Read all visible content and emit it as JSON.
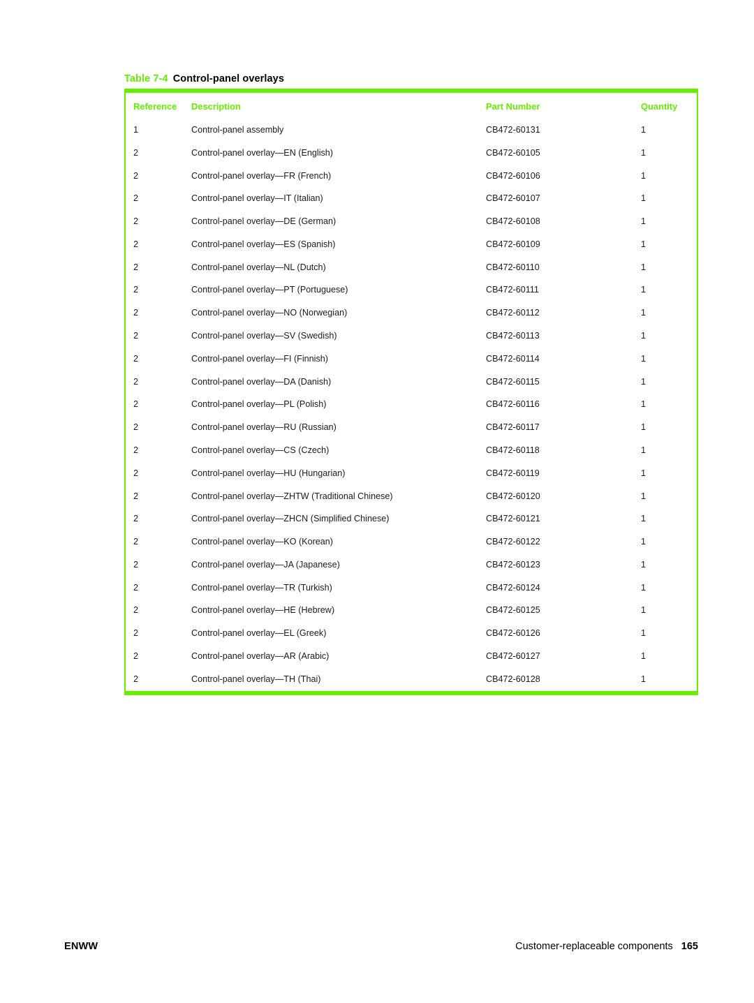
{
  "caption": {
    "label": "Table 7-4",
    "title": "Control-panel overlays"
  },
  "colors": {
    "accent_green": "#66ee00",
    "body_text": "#1a1a1a"
  },
  "table": {
    "headers": {
      "reference": "Reference",
      "description": "Description",
      "part_number": "Part Number",
      "quantity": "Quantity"
    },
    "rows": [
      {
        "reference": "1",
        "description": "Control-panel assembly",
        "part_number": "CB472-60131",
        "quantity": "1"
      },
      {
        "reference": "2",
        "description": "Control-panel overlay—EN (English)",
        "part_number": "CB472-60105",
        "quantity": "1"
      },
      {
        "reference": "2",
        "description": "Control-panel overlay—FR (French)",
        "part_number": "CB472-60106",
        "quantity": "1"
      },
      {
        "reference": "2",
        "description": "Control-panel overlay—IT (Italian)",
        "part_number": "CB472-60107",
        "quantity": "1"
      },
      {
        "reference": "2",
        "description": "Control-panel overlay—DE (German)",
        "part_number": "CB472-60108",
        "quantity": "1"
      },
      {
        "reference": "2",
        "description": "Control-panel overlay—ES (Spanish)",
        "part_number": "CB472-60109",
        "quantity": "1"
      },
      {
        "reference": "2",
        "description": "Control-panel overlay—NL (Dutch)",
        "part_number": "CB472-60110",
        "quantity": "1"
      },
      {
        "reference": "2",
        "description": "Control-panel overlay—PT (Portuguese)",
        "part_number": "CB472-60111",
        "quantity": "1"
      },
      {
        "reference": "2",
        "description": "Control-panel overlay—NO (Norwegian)",
        "part_number": "CB472-60112",
        "quantity": "1"
      },
      {
        "reference": "2",
        "description": "Control-panel overlay—SV (Swedish)",
        "part_number": "CB472-60113",
        "quantity": "1"
      },
      {
        "reference": "2",
        "description": "Control-panel overlay—FI (Finnish)",
        "part_number": "CB472-60114",
        "quantity": "1"
      },
      {
        "reference": "2",
        "description": "Control-panel overlay—DA (Danish)",
        "part_number": "CB472-60115",
        "quantity": "1"
      },
      {
        "reference": "2",
        "description": "Control-panel overlay—PL (Polish)",
        "part_number": "CB472-60116",
        "quantity": "1"
      },
      {
        "reference": "2",
        "description": "Control-panel overlay—RU (Russian)",
        "part_number": "CB472-60117",
        "quantity": "1"
      },
      {
        "reference": "2",
        "description": "Control-panel overlay—CS (Czech)",
        "part_number": "CB472-60118",
        "quantity": "1"
      },
      {
        "reference": "2",
        "description": "Control-panel overlay—HU (Hungarian)",
        "part_number": "CB472-60119",
        "quantity": "1"
      },
      {
        "reference": "2",
        "description": "Control-panel overlay—ZHTW (Traditional Chinese)",
        "part_number": "CB472-60120",
        "quantity": "1"
      },
      {
        "reference": "2",
        "description": "Control-panel overlay—ZHCN (Simplified Chinese)",
        "part_number": "CB472-60121",
        "quantity": "1"
      },
      {
        "reference": "2",
        "description": "Control-panel overlay—KO (Korean)",
        "part_number": "CB472-60122",
        "quantity": "1"
      },
      {
        "reference": "2",
        "description": "Control-panel overlay—JA (Japanese)",
        "part_number": "CB472-60123",
        "quantity": "1"
      },
      {
        "reference": "2",
        "description": "Control-panel overlay—TR (Turkish)",
        "part_number": "CB472-60124",
        "quantity": "1"
      },
      {
        "reference": "2",
        "description": "Control-panel overlay—HE (Hebrew)",
        "part_number": "CB472-60125",
        "quantity": "1"
      },
      {
        "reference": "2",
        "description": "Control-panel overlay—EL (Greek)",
        "part_number": "CB472-60126",
        "quantity": "1"
      },
      {
        "reference": "2",
        "description": "Control-panel overlay—AR (Arabic)",
        "part_number": "CB472-60127",
        "quantity": "1"
      },
      {
        "reference": "2",
        "description": "Control-panel overlay—TH (Thai)",
        "part_number": "CB472-60128",
        "quantity": "1"
      }
    ]
  },
  "footer": {
    "left": "ENWW",
    "section": "Customer-replaceable components",
    "page_number": "165"
  }
}
